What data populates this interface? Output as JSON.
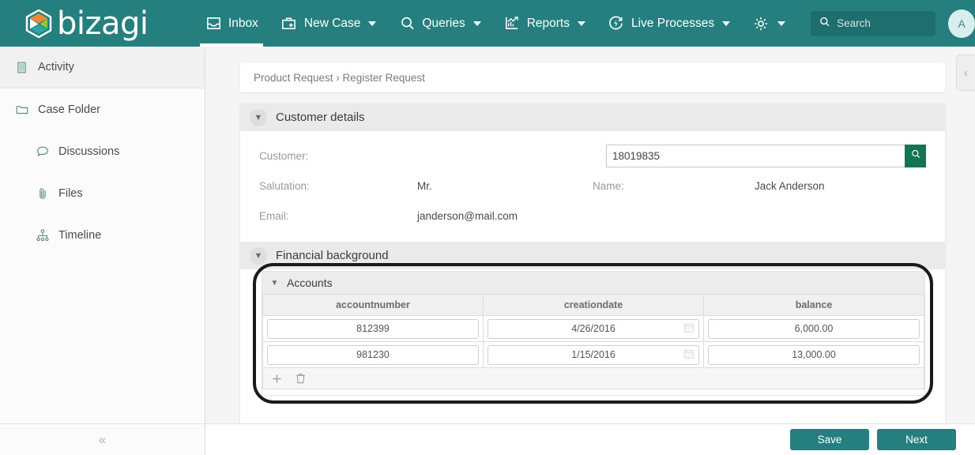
{
  "brand": {
    "name": "bizagi",
    "accent": "#257f7f",
    "logo_icon": "bizagi-hexagon-logo"
  },
  "topnav": {
    "items": [
      {
        "label": "Inbox",
        "icon": "inbox-icon",
        "caret": false,
        "active": true
      },
      {
        "label": "New Case",
        "icon": "briefcase-plus-icon",
        "caret": true,
        "active": false
      },
      {
        "label": "Queries",
        "icon": "search-icon",
        "caret": true,
        "active": false
      },
      {
        "label": "Reports",
        "icon": "chart-icon",
        "caret": true,
        "active": false
      },
      {
        "label": "Live Processes",
        "icon": "live-process-icon",
        "caret": true,
        "active": false
      },
      {
        "label": "",
        "icon": "gear-icon",
        "caret": true,
        "active": false
      }
    ],
    "search": {
      "placeholder": "Search",
      "icon": "search-icon"
    },
    "avatar": {
      "initial": "A"
    }
  },
  "sidebar": {
    "items": [
      {
        "label": "Activity",
        "icon": "activity-icon",
        "active": true,
        "sub": false
      },
      {
        "label": "Case Folder",
        "icon": "folder-icon",
        "active": false,
        "sub": false
      },
      {
        "label": "Discussions",
        "icon": "discussion-icon",
        "active": false,
        "sub": true
      },
      {
        "label": "Files",
        "icon": "paperclip-icon",
        "active": false,
        "sub": true
      },
      {
        "label": "Timeline",
        "icon": "timeline-icon",
        "active": false,
        "sub": true
      }
    ],
    "collapse_icon": "double-chevron-left-icon"
  },
  "main": {
    "right_panel_toggle_icon": "chevron-left-icon",
    "breadcrumb": "Product Request › Register Request",
    "sections": {
      "customer": {
        "title": "Customer details",
        "toggle_icon": "chevron-down-icon",
        "fields": {
          "customer_label": "Customer:",
          "customer_value": "18019835",
          "customer_search_icon": "search-icon",
          "salutation_label": "Salutation:",
          "salutation_value": "Mr.",
          "name_label": "Name:",
          "name_value": "Jack Anderson",
          "email_label": "Email:",
          "email_value": "janderson@mail.com"
        }
      },
      "financial": {
        "title": "Financial background",
        "toggle_icon": "chevron-down-icon"
      },
      "accounts": {
        "title": "Accounts",
        "toggle_icon": "chevron-down-icon",
        "columns": [
          "accountnumber",
          "creationdate",
          "balance"
        ],
        "rows": [
          {
            "accountnumber": "812399",
            "creationdate": "4/26/2016",
            "balance": "6,000.00"
          },
          {
            "accountnumber": "981230",
            "creationdate": "1/15/2016",
            "balance": "13,000.00"
          }
        ],
        "date_icon": "calendar-icon",
        "footer": {
          "add_icon": "plus-icon",
          "delete_icon": "trash-icon"
        }
      }
    }
  },
  "footer": {
    "save_label": "Save",
    "next_label": "Next"
  }
}
